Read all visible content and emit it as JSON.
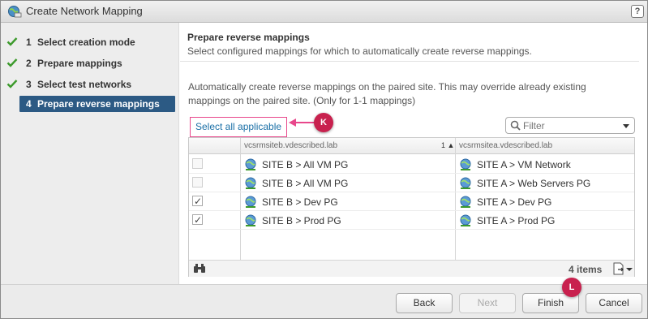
{
  "window": {
    "title": "Create Network Mapping",
    "help_label": "?"
  },
  "nav": {
    "items": [
      {
        "num": "1",
        "label": "Select creation mode",
        "done": true
      },
      {
        "num": "2",
        "label": "Prepare mappings",
        "done": true
      },
      {
        "num": "3",
        "label": "Select test networks",
        "done": true
      },
      {
        "num": "4",
        "label": "Prepare reverse mappings",
        "done": false,
        "active": true
      }
    ]
  },
  "main": {
    "title": "Prepare reverse mappings",
    "subtitle": "Select configured mappings for which to automatically create reverse mappings.",
    "description": "Automatically create reverse mappings on the paired site. This may override already existing mappings on the paired site. (Only for 1-1 mappings)",
    "select_all_label": "Select all applicable",
    "filter_placeholder": "Filter"
  },
  "table": {
    "columns": [
      "",
      "vcsrmsiteb.vdescribed.lab",
      "vcsrmsitea.vdescribed.lab"
    ],
    "sort_indicator": "1 ▲",
    "rows": [
      {
        "checked": false,
        "enabled": false,
        "source": "SITE B > All VM PG",
        "target": "SITE A > VM Network"
      },
      {
        "checked": false,
        "enabled": false,
        "source": "SITE B > All VM PG",
        "target": "SITE A > Web Servers PG"
      },
      {
        "checked": true,
        "enabled": true,
        "source": "SITE B > Dev PG",
        "target": "SITE A > Dev PG"
      },
      {
        "checked": true,
        "enabled": true,
        "source": "SITE B > Prod PG",
        "target": "SITE A > Prod PG"
      }
    ],
    "item_count": "4 items"
  },
  "footer": {
    "back": "Back",
    "next": "Next",
    "finish": "Finish",
    "cancel": "Cancel"
  },
  "callouts": {
    "k": "K",
    "l": "L"
  },
  "colors": {
    "accent": "#2c5a84",
    "callout": "#c8214e",
    "highlight_border": "#e8478b",
    "link": "#1a6fa6",
    "check_green": "#3c9a2c"
  }
}
